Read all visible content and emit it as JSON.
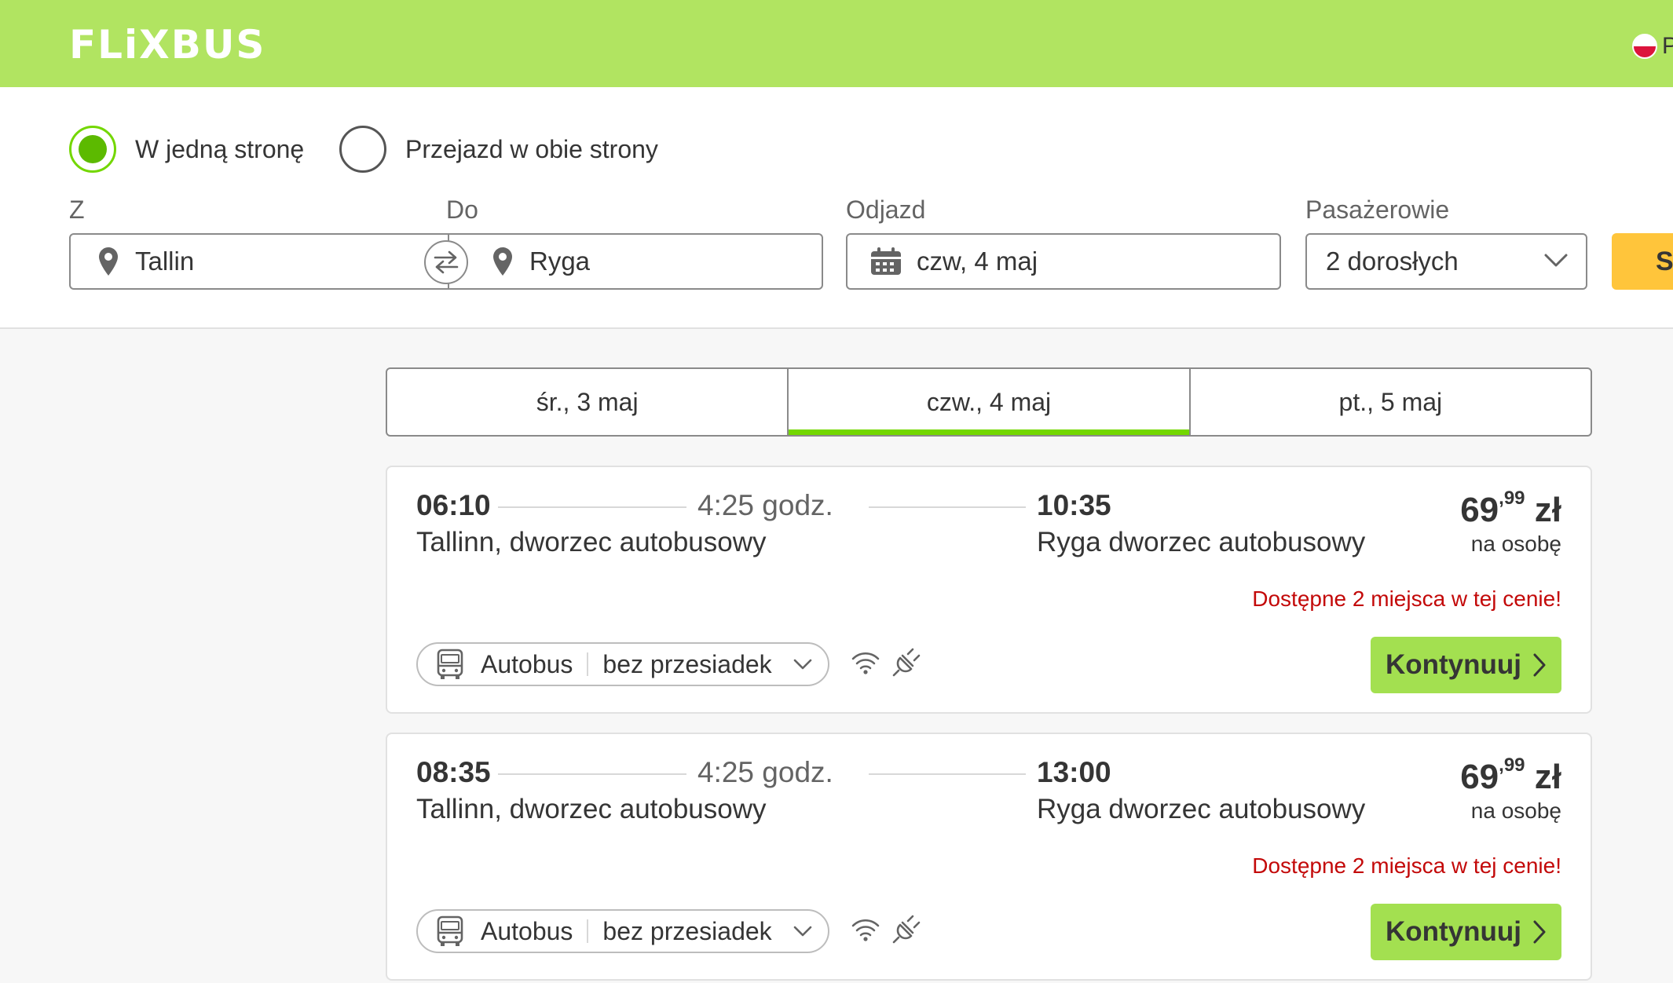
{
  "header": {
    "logo": "FLiXBUS",
    "language_code": "PL"
  },
  "search": {
    "trip_type_one_way": "W jedną stronę",
    "trip_type_round": "Przejazd w obie strony",
    "from_label": "Z",
    "from_value": "Tallin",
    "to_label": "Do",
    "to_value": "Ryga",
    "departure_label": "Odjazd",
    "departure_value": "czw, 4 maj",
    "passengers_label": "Pasażerowie",
    "passengers_value": "2 dorosłych",
    "search_button": "S"
  },
  "date_tabs": [
    {
      "label": "śr., 3 maj",
      "active": false
    },
    {
      "label": "czw., 4 maj",
      "active": true
    },
    {
      "label": "pt., 5 maj",
      "active": false
    }
  ],
  "rides": [
    {
      "dep_time": "06:10",
      "duration": "4:25 godz.",
      "arr_time": "10:35",
      "dep_station": "Tallinn, dworzec autobusowy",
      "arr_station": "Ryga dworzec autobusowy",
      "price_int": "69",
      "price_dec": ",99",
      "currency": "zł",
      "price_note": "na osobę",
      "seats": "Dostępne 2 miejsca w tej cenie!",
      "vehicle": "Autobus",
      "transfers": "bez przesiadek",
      "cta": "Kontynuuj"
    },
    {
      "dep_time": "08:35",
      "duration": "4:25 godz.",
      "arr_time": "13:00",
      "dep_station": "Tallinn, dworzec autobusowy",
      "arr_station": "Ryga dworzec autobusowy",
      "price_int": "69",
      "price_dec": ",99",
      "currency": "zł",
      "price_note": "na osobę",
      "seats": "Dostępne 2 miejsca w tej cenie!",
      "vehicle": "Autobus",
      "transfers": "bez przesiadek",
      "cta": "Kontynuuj"
    }
  ],
  "colors": {
    "brand_green": "#b1e461",
    "accent_green": "#73d700",
    "cta_green": "#a3e050",
    "search_yellow": "#ffc53b",
    "alert_red": "#c30909"
  },
  "icons": [
    "location-pin-icon",
    "swap-icon",
    "calendar-icon",
    "chevron-down-icon",
    "bus-icon",
    "wifi-icon",
    "power-plug-icon",
    "chevron-right-icon"
  ]
}
